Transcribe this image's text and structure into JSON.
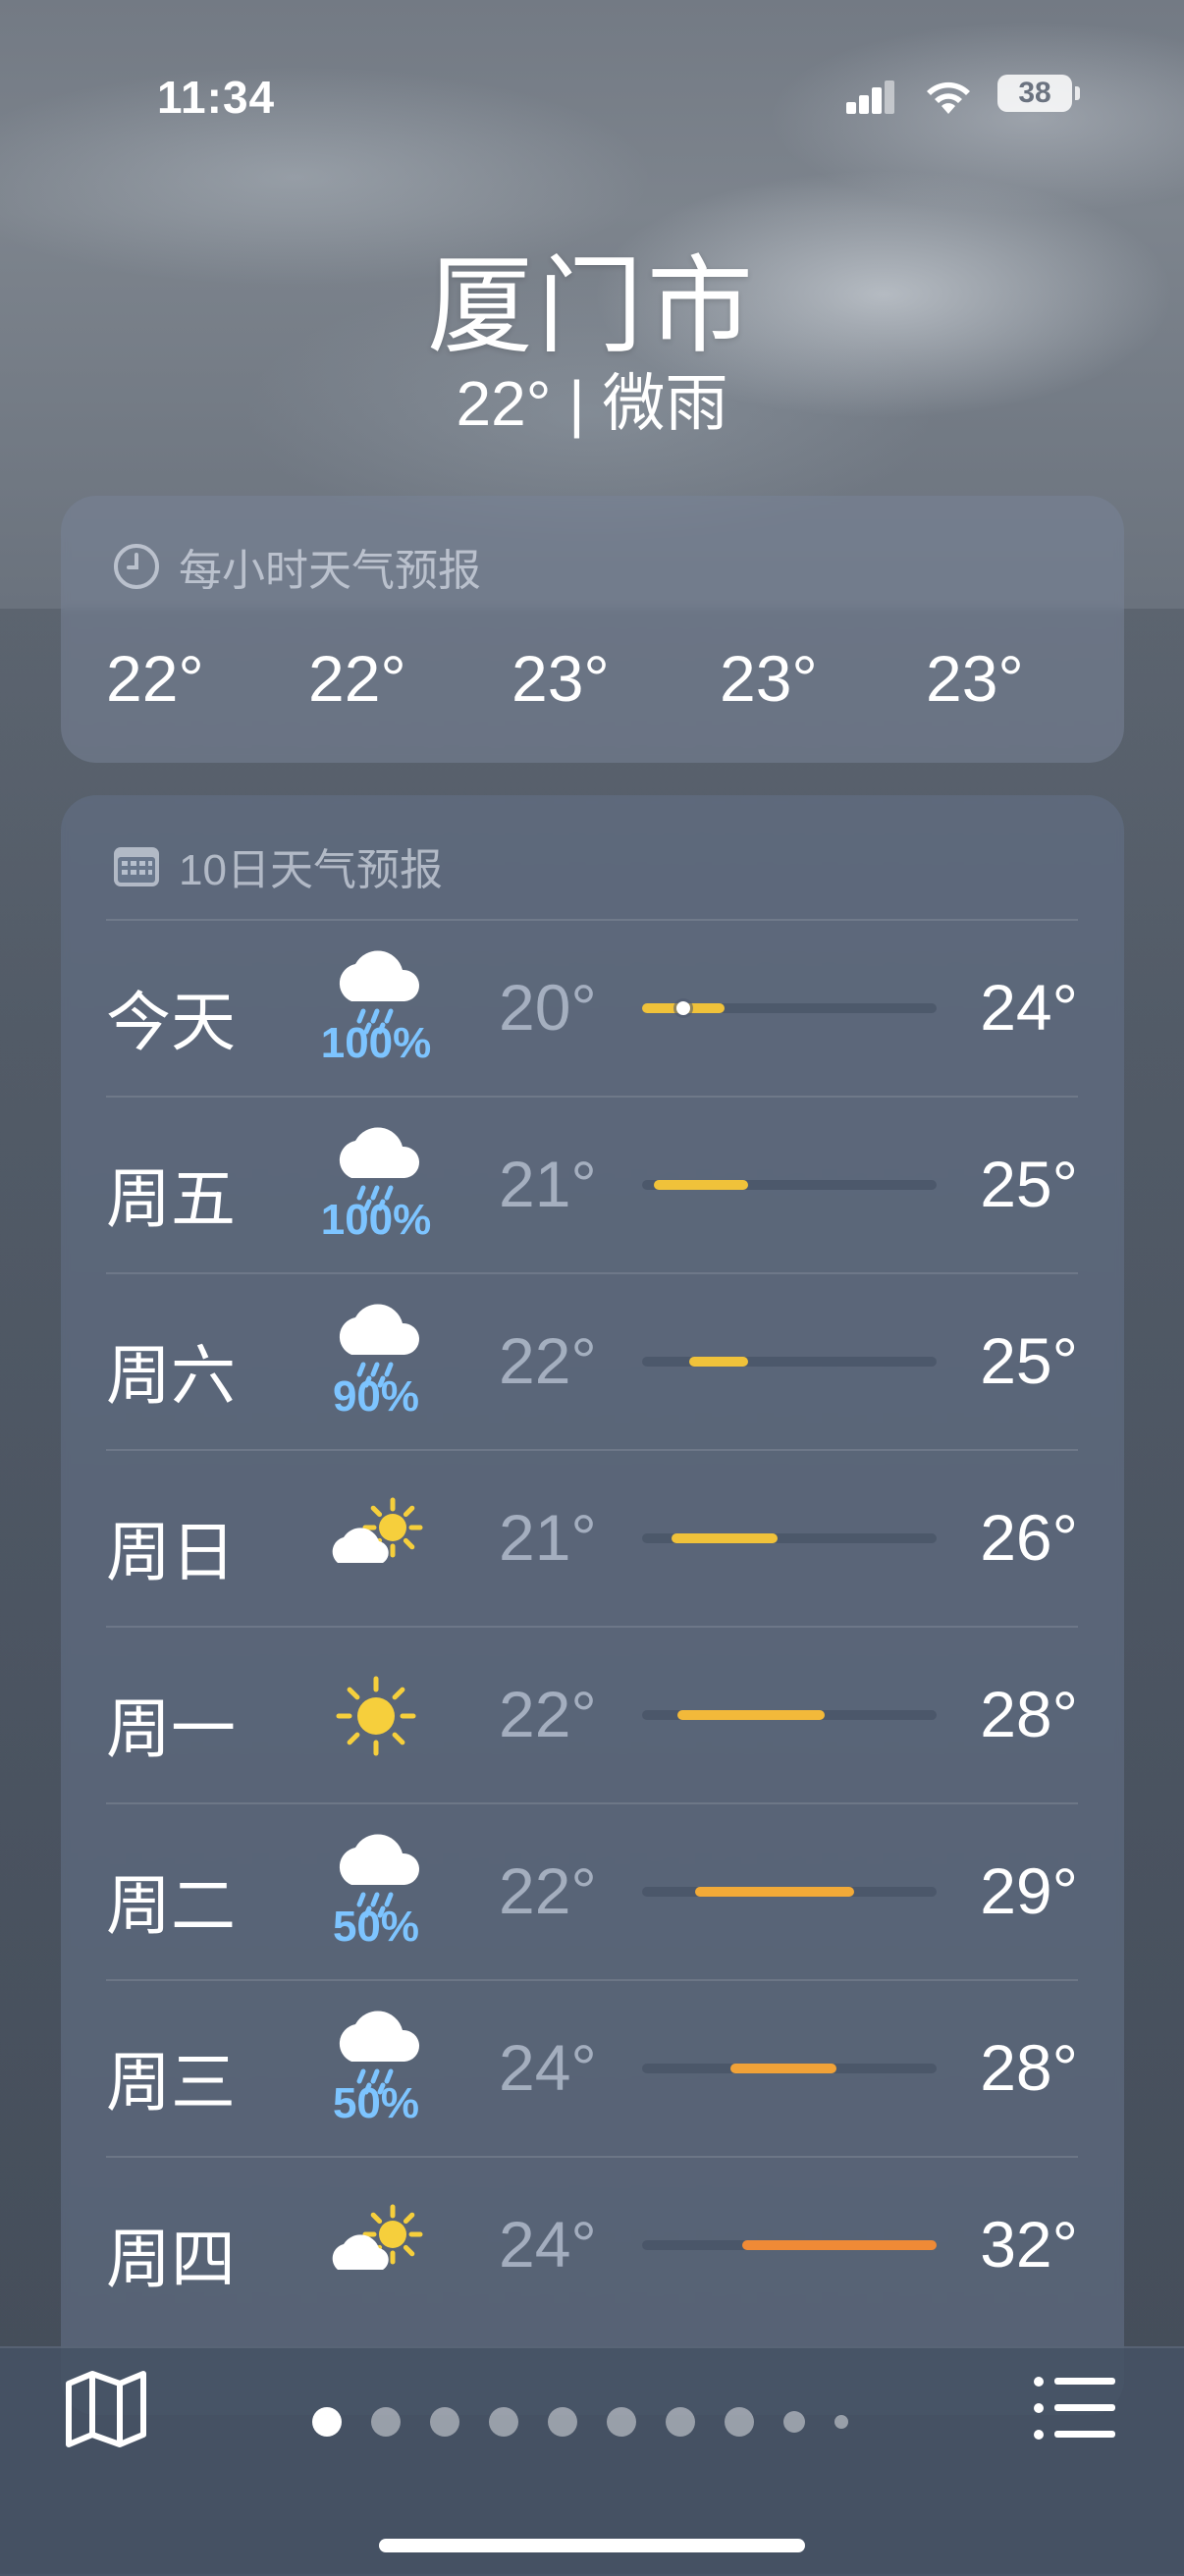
{
  "status": {
    "time": "11:34",
    "battery": "38",
    "icons": [
      "cellular-signal-icon",
      "wifi-icon",
      "battery-icon"
    ]
  },
  "location": {
    "city": "厦门市",
    "summary": "22° | 微雨"
  },
  "hourly": {
    "title": "每小时天气预报",
    "icon": "clock-icon",
    "temps": [
      "22°",
      "22°",
      "23°",
      "23°",
      "23°"
    ]
  },
  "daily": {
    "title": "10日天气预报",
    "icon": "calendar-icon",
    "days": [
      {
        "day": "今天",
        "icon": "rain-cloud-icon",
        "precip": "100%",
        "low": "20°",
        "high": "24°",
        "bar": [
          0.0,
          0.28
        ],
        "color": "#f0c23a",
        "current": 0.14
      },
      {
        "day": "周五",
        "icon": "rain-cloud-icon",
        "precip": "100%",
        "low": "21°",
        "high": "25°",
        "bar": [
          0.04,
          0.36
        ],
        "color": "#f0c23a"
      },
      {
        "day": "周六",
        "icon": "rain-cloud-icon",
        "precip": "90%",
        "low": "22°",
        "high": "25°",
        "bar": [
          0.16,
          0.36
        ],
        "color": "#f0c23a"
      },
      {
        "day": "周日",
        "icon": "partly-sunny-icon",
        "precip": "",
        "low": "21°",
        "high": "26°",
        "bar": [
          0.1,
          0.46
        ],
        "color": "#f0c23a"
      },
      {
        "day": "周一",
        "icon": "sun-icon",
        "precip": "",
        "low": "22°",
        "high": "28°",
        "bar": [
          0.12,
          0.62
        ],
        "color": "#f2b93a"
      },
      {
        "day": "周二",
        "icon": "rain-cloud-icon",
        "precip": "50%",
        "low": "22°",
        "high": "29°",
        "bar": [
          0.18,
          0.72
        ],
        "color": "#f2aa38"
      },
      {
        "day": "周三",
        "icon": "rain-cloud-icon",
        "precip": "50%",
        "low": "24°",
        "high": "28°",
        "bar": [
          0.3,
          0.66
        ],
        "color": "#f0a238"
      },
      {
        "day": "周四",
        "icon": "partly-sunny-icon",
        "precip": "",
        "low": "24°",
        "high": "32°",
        "bar": [
          0.34,
          1.0
        ],
        "color": "#ef8a36"
      }
    ]
  },
  "pager": {
    "count": 10,
    "active": 0
  },
  "toolbar": {
    "map": "map-icon",
    "list": "list-icon"
  }
}
